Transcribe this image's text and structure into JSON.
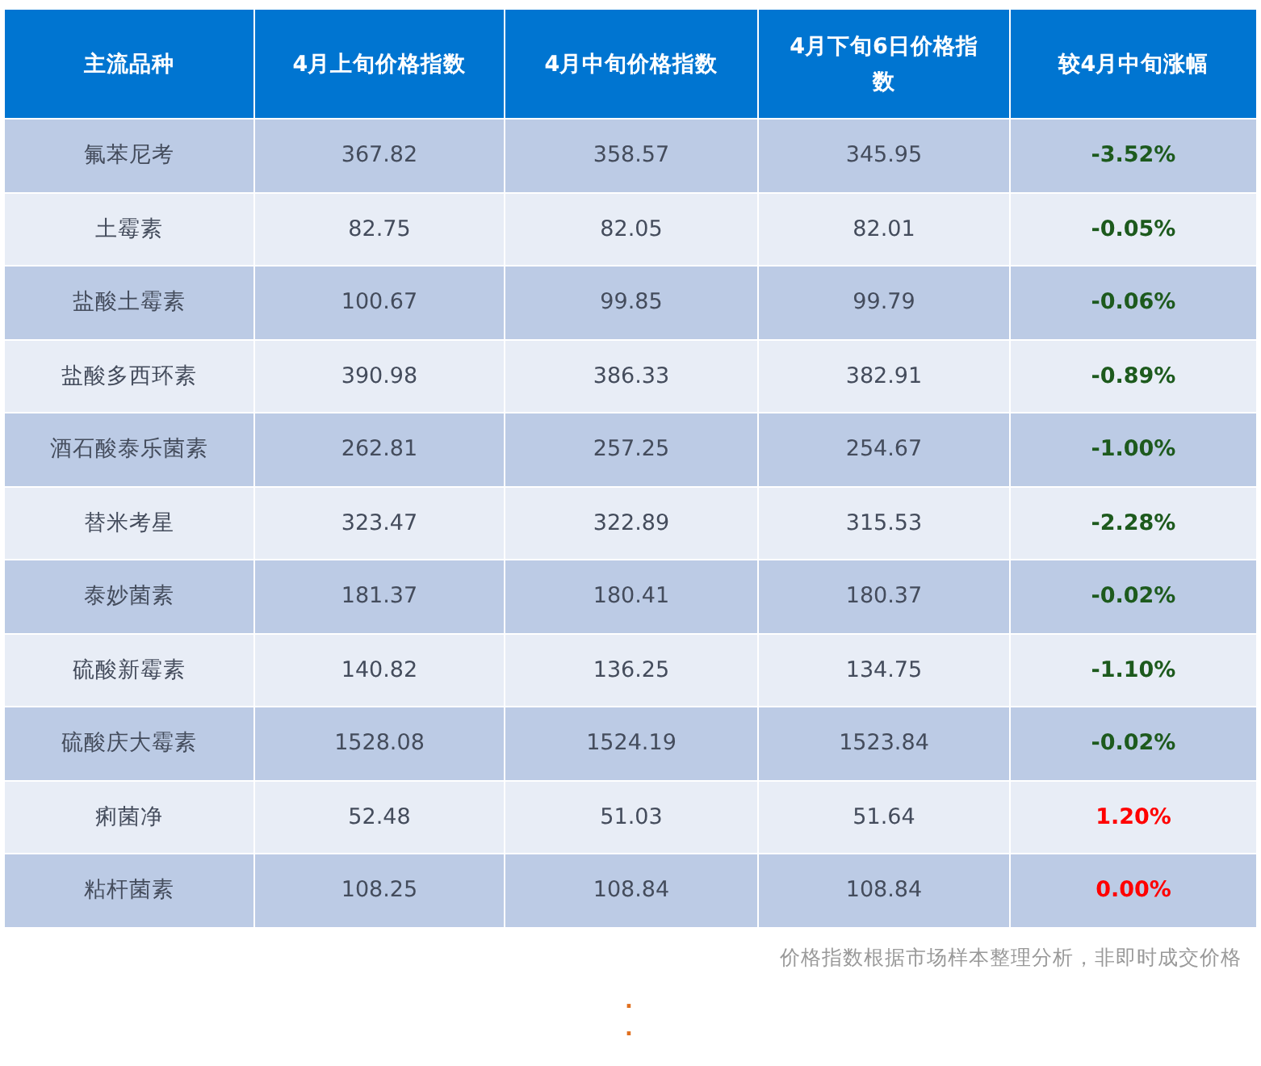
{
  "table": {
    "columns": [
      "主流品种",
      "4月上旬价格指数",
      "4月中旬价格指数",
      "4月下旬6日价格指数",
      "较4月中旬涨幅"
    ],
    "rows": [
      {
        "cells": [
          "氟苯尼考",
          "367.82",
          "358.57",
          "345.95",
          "-3.52%"
        ],
        "color": "#1d5a1d"
      },
      {
        "cells": [
          "土霉素",
          "82.75",
          "82.05",
          "82.01",
          "-0.05%"
        ],
        "color": "#1d5a1d"
      },
      {
        "cells": [
          "盐酸土霉素",
          "100.67",
          "99.85",
          "99.79",
          "-0.06%"
        ],
        "color": "#1d5a1d"
      },
      {
        "cells": [
          "盐酸多西环素",
          "390.98",
          "386.33",
          "382.91",
          "-0.89%"
        ],
        "color": "#1d5a1d"
      },
      {
        "cells": [
          "酒石酸泰乐菌素",
          "262.81",
          "257.25",
          "254.67",
          "-1.00%"
        ],
        "color": "#1d5a1d"
      },
      {
        "cells": [
          "替米考星",
          "323.47",
          "322.89",
          "315.53",
          "-2.28%"
        ],
        "color": "#1d5a1d"
      },
      {
        "cells": [
          "泰妙菌素",
          "181.37",
          "180.41",
          "180.37",
          "-0.02%"
        ],
        "color": "#1d5a1d"
      },
      {
        "cells": [
          "硫酸新霉素",
          "140.82",
          "136.25",
          "134.75",
          "-1.10%"
        ],
        "color": "#1d5a1d"
      },
      {
        "cells": [
          "硫酸庆大霉素",
          "1528.08",
          "1524.19",
          "1523.84",
          "-0.02%"
        ],
        "color": "#1d5a1d"
      },
      {
        "cells": [
          "痢菌净",
          "52.48",
          "51.03",
          "51.64",
          "1.20%"
        ],
        "color": "#ff0000"
      },
      {
        "cells": [
          "粘杆菌素",
          "108.25",
          "108.84",
          "108.84",
          "0.00%"
        ],
        "color": "#ff0000"
      }
    ]
  },
  "footnote": "价格指数根据市场样本整理分析，非即时成交价格",
  "dots": [
    ".",
    "."
  ]
}
